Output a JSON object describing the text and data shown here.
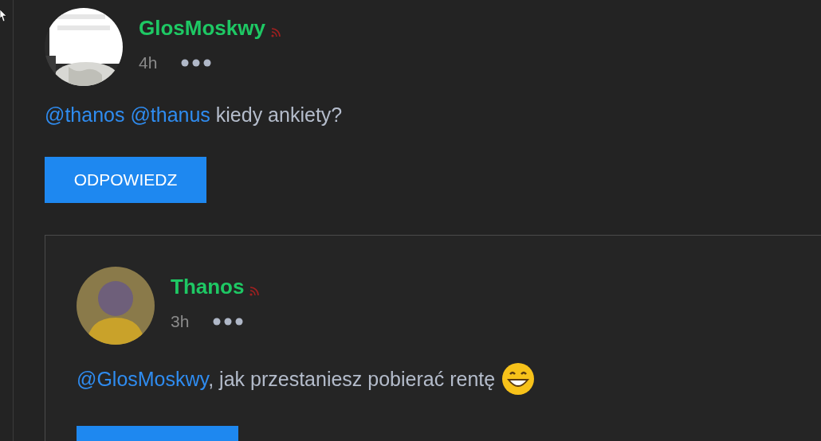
{
  "comments": [
    {
      "author": "GlosMoskwy",
      "time": "4h",
      "body": [
        {
          "kind": "mention",
          "text": "@thanos"
        },
        {
          "kind": "mention",
          "text": "@thanus"
        },
        {
          "kind": "text",
          "text": "kiedy ankiety?"
        }
      ],
      "reply_label": "ODPOWIEDZ"
    },
    {
      "author": "Thanos",
      "time": "3h",
      "avatar": {
        "kind": "silhouette"
      },
      "body": [
        {
          "kind": "mention",
          "text": "@GlosMoskwy"
        },
        {
          "kind": "text",
          "text": ", jak przestaniesz pobierać rentę",
          "attached": true
        },
        {
          "kind": "emoji"
        }
      ],
      "nested": true
    }
  ]
}
